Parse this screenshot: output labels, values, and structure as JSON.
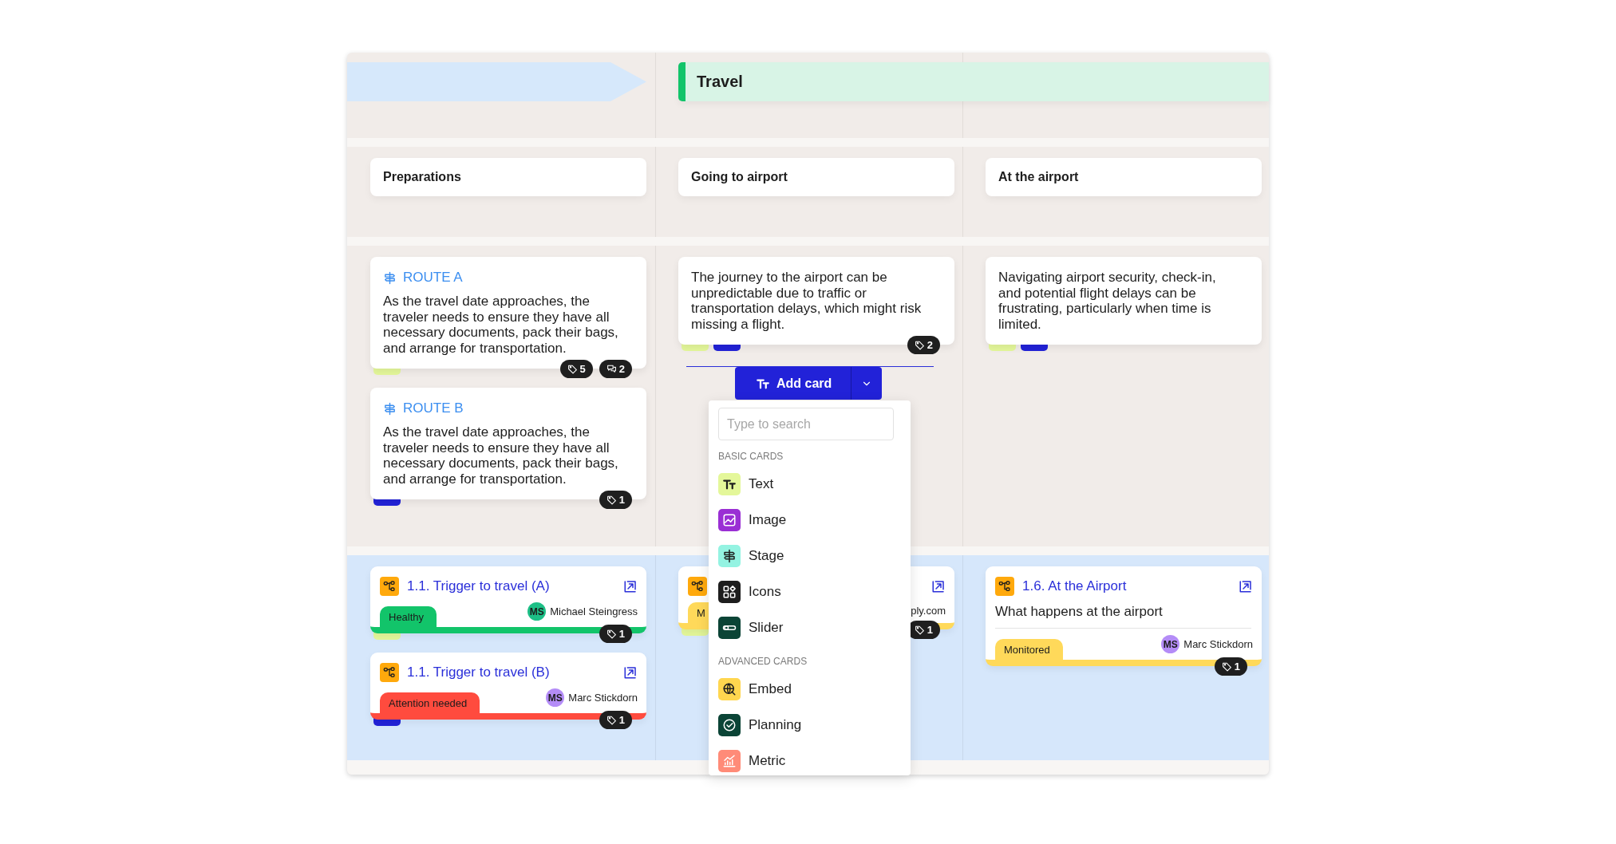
{
  "lanes": [
    {
      "kind": "arrow"
    },
    {
      "kind": "band",
      "title": "Travel"
    }
  ],
  "steps": [
    {
      "title": "Preparations"
    },
    {
      "title": "Going to airport"
    },
    {
      "title": "At the airport"
    }
  ],
  "content_columns": [
    {
      "cards": [
        {
          "kind": "stage",
          "heading": "ROUTE A",
          "body": "As the travel date approaches, the traveler needs to ensure they have all necessary documents, pack their bags, and arrange for transportation.",
          "stack_tabs": [
            {
              "color": "#e4f79a"
            }
          ],
          "badges": [
            {
              "kind": "tag",
              "count": "5"
            },
            {
              "kind": "comment",
              "count": "2"
            }
          ]
        },
        {
          "kind": "stage",
          "heading": "ROUTE B",
          "body": "As the travel date approaches, the traveler needs to ensure they have all necessary documents, pack their bags, and arrange for transportation.",
          "stack_tabs": [
            {
              "color": "#2222d8"
            }
          ],
          "badges": [
            {
              "kind": "tag",
              "count": "1"
            }
          ]
        }
      ]
    },
    {
      "cards": [
        {
          "kind": "text",
          "body": "The journey to the airport can be unpredictable due to traffic or transportation delays, which might risk missing a flight.",
          "stack_tabs": [
            {
              "color": "#e4f79a"
            },
            {
              "color": "#2222d8"
            }
          ],
          "badges": [
            {
              "kind": "tag",
              "count": "2"
            }
          ]
        }
      ]
    },
    {
      "cards": [
        {
          "kind": "text",
          "body": "Navigating airport security, check-in, and potential flight delays can be frustrating, particularly when time is limited.",
          "stack_tabs": [
            {
              "color": "#e4f79a"
            },
            {
              "color": "#2222d8"
            }
          ]
        }
      ]
    }
  ],
  "add_card": {
    "label": "Add card",
    "menu": {
      "search": {
        "placeholder": "Type to search"
      },
      "sections": [
        {
          "title": "BASIC CARDS",
          "items": [
            {
              "label": "Text",
              "kind": "text",
              "color": "#e4f79a"
            },
            {
              "label": "Image",
              "kind": "image",
              "color": "#9a2fd4"
            },
            {
              "label": "Stage",
              "kind": "stage",
              "color": "#94f3e2"
            },
            {
              "label": "Icons",
              "kind": "icons",
              "color": "#1e1e1e"
            },
            {
              "label": "Slider",
              "kind": "slider",
              "color": "#0b4436"
            }
          ]
        },
        {
          "title": "ADVANCED CARDS",
          "items": [
            {
              "label": "Embed",
              "kind": "embed",
              "color": "#ffd64f"
            },
            {
              "label": "Planning",
              "kind": "planning",
              "color": "#0b4436"
            },
            {
              "label": "Metric",
              "kind": "metric",
              "color": "#ff8b78"
            }
          ]
        }
      ]
    }
  },
  "journey_columns": [
    {
      "cards": [
        {
          "title": "1.1. Trigger to travel (A)",
          "status": {
            "label": "Healthy",
            "color": "#12c46a"
          },
          "avatar": {
            "initials": "MS",
            "color": "#1dbf86"
          },
          "owner": "Michael Steingress",
          "tag_count": "1",
          "stack_tabs": [
            {
              "color": "#e4f79a"
            }
          ]
        },
        {
          "title": "1.1. Trigger to travel (B)",
          "status": {
            "label": "Attention needed",
            "color": "#ff4b3e"
          },
          "avatar": {
            "initials": "MS",
            "color": "#b48cf7"
          },
          "owner": "Marc Stickdorn",
          "tag_count": "1",
          "stack_tabs": [
            {
              "color": "#2222d8"
            }
          ]
        }
      ]
    },
    {
      "cards": [
        {
          "status": {
            "label": "M",
            "color": "#ffd95a"
          },
          "owner": "ply.com",
          "tag_count": "1",
          "stack_tabs": [
            {
              "color": "#e4f79a"
            }
          ]
        }
      ]
    },
    {
      "cards": [
        {
          "title": "1.6. At the Airport",
          "description": "What happens at the airport",
          "status": {
            "label": "Monitored",
            "color": "#ffd95a"
          },
          "avatar": {
            "initials": "MS",
            "color": "#b48cf7"
          },
          "owner": "Marc Stickdorn",
          "tag_count": "1"
        }
      ]
    }
  ]
}
